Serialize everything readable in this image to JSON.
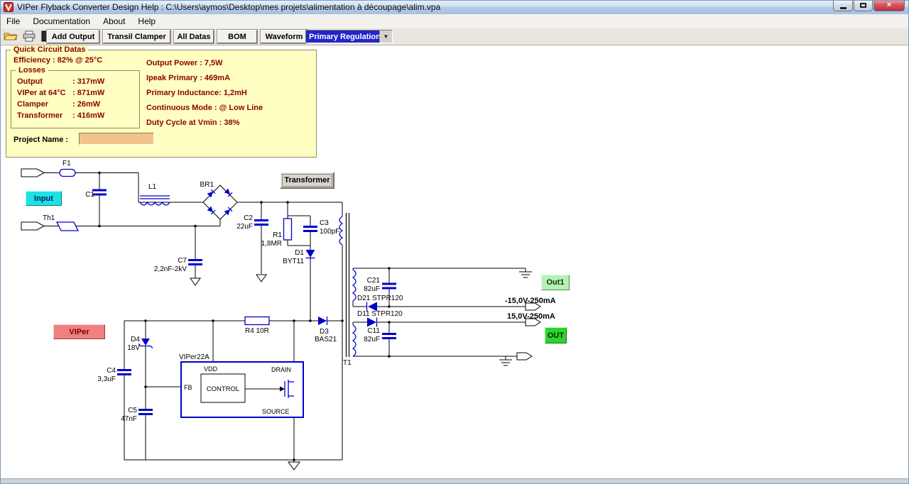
{
  "window": {
    "title": "VIPer Flyback Converter Design Help :  C:\\Users\\aymos\\Desktop\\mes projets\\alimentation à découpage\\alim.vpa",
    "controls": [
      "minimize",
      "maximize",
      "close"
    ]
  },
  "menu": {
    "items": [
      {
        "label": "File"
      },
      {
        "label": "Documentation"
      },
      {
        "label": "About"
      },
      {
        "label": "Help"
      }
    ]
  },
  "toolbar": {
    "icons": [
      "open-folder-icon",
      "print-icon",
      "exit-icon"
    ],
    "buttons": [
      {
        "label": "Add Output"
      },
      {
        "label": "Transil Clamper"
      },
      {
        "label": "All Datas"
      },
      {
        "label": "BOM"
      },
      {
        "label": "Waveform"
      }
    ],
    "regulation_combo": {
      "value": "Primary Regulation"
    }
  },
  "quick_panel": {
    "title": "Quick Circuit Datas",
    "efficiency": "Efficiency : 82% @ 25°C",
    "losses": {
      "title": "Losses",
      "rows": [
        {
          "label": "Output",
          "value": ": 317mW"
        },
        {
          "label": "VIPer at 64°C",
          "value": ": 871mW"
        },
        {
          "label": "Clamper",
          "value": ": 26mW"
        },
        {
          "label": "Transformer",
          "value": ": 416mW"
        }
      ]
    },
    "stats": [
      "Output Power : 7,5W",
      "Ipeak Primary : 469mA",
      "Primary Inductance: 1,2mH",
      "Continuous Mode : @ Low Line",
      "Duty Cycle at Vmin : 38%"
    ],
    "project_label": "Project Name :",
    "project_value": ""
  },
  "schematic": {
    "buttons": {
      "input": "Input",
      "viper": "VIPer",
      "transformer": "Transformer",
      "out1": "Out1",
      "out": "OUT"
    },
    "labels": {
      "f1": "F1",
      "c1": "C1",
      "th1": "Th1",
      "l1": "L1",
      "br1": "BR1",
      "c2": "C2",
      "c2_val": "22uF",
      "r1": "R1",
      "r1_val": "1,8MR",
      "c3": "C3",
      "c3_val": "100pF",
      "c7": "C7",
      "c7_val": "2,2nF-2kV",
      "d1": "D1",
      "d1_val": "BYT11",
      "r4": "R4 10R",
      "d3": "D3",
      "d3_val": "BAS21",
      "d4": "D4",
      "d4_val": "18V",
      "c4": "C4",
      "c4_val": "3,3uF",
      "c5": "C5",
      "c5_val": "47nF",
      "ic_name": "VIPer22A",
      "pin_vdd": "VDD",
      "pin_drain": "DRAIN",
      "pin_fb": "FB",
      "pin_source": "SOURCE",
      "control": "CONTROL",
      "t1": "T1",
      "c21": "C21",
      "c21_val": "82uF",
      "d21": "D21 STPR120",
      "d11": "D11 STPR120",
      "c11": "C11",
      "c11_val": "82uF",
      "out1_rating": "-15,0V-250mA",
      "out_rating": "15,0V-250mA"
    }
  }
}
